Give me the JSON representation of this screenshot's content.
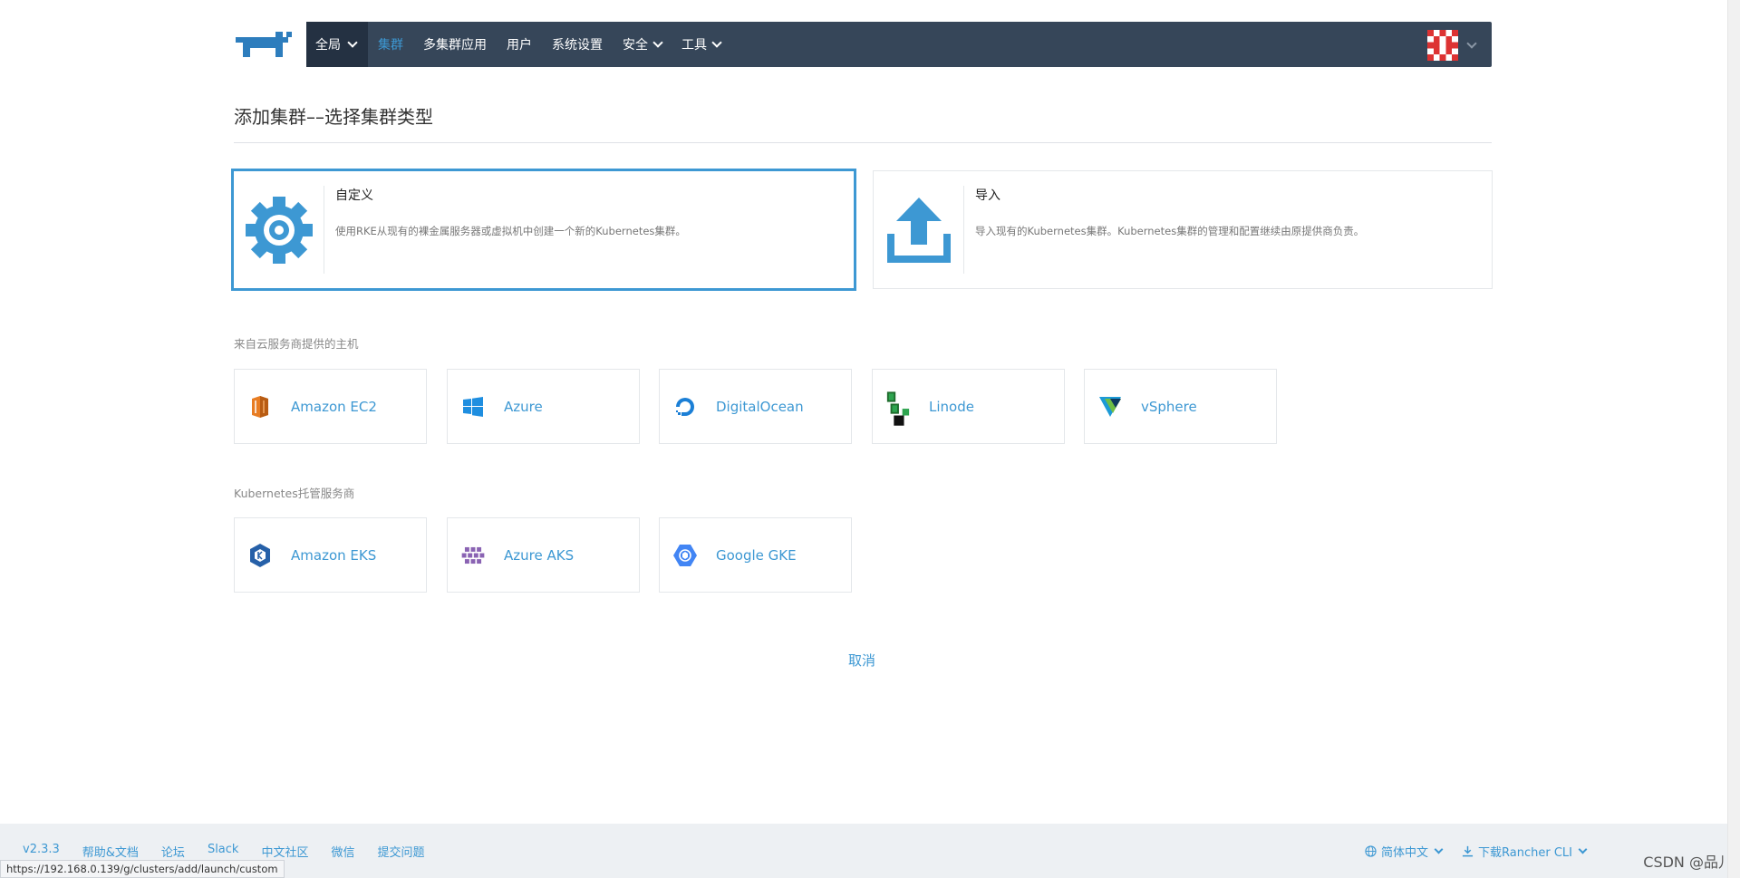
{
  "nav": {
    "scope": "全局",
    "items": [
      "集群",
      "多集群应用",
      "用户",
      "系统设置",
      "安全",
      "工具"
    ]
  },
  "page": {
    "title": "添加集群––选择集群类型"
  },
  "big_cards": [
    {
      "title": "自定义",
      "desc": "使用RKE从现有的裸金属服务器或虚拟机中创建一个新的Kubernetes集群。",
      "icon": "gear-icon"
    },
    {
      "title": "导入",
      "desc": "导入现有的Kubernetes集群。Kubernetes集群的管理和配置继续由原提供商负责。",
      "icon": "upload-icon"
    }
  ],
  "sections": {
    "cloud_hosts": "来自云服务商提供的主机",
    "k8s_hosted": "Kubernetes托管服务商"
  },
  "cloud_providers": [
    "Amazon EC2",
    "Azure",
    "DigitalOcean",
    "Linode",
    "vSphere"
  ],
  "hosted_providers": [
    "Amazon EKS",
    "Azure AKS",
    "Google GKE"
  ],
  "cancel_label": "取消",
  "footer": {
    "links": [
      "v2.3.3",
      "帮助&文档",
      "论坛",
      "Slack",
      "中文社区",
      "微信",
      "提交问题"
    ],
    "language": "简体中文",
    "download": "下载Rancher CLI"
  },
  "status_url": "https://192.168.0.139/g/clusters/add/launch/custom",
  "watermark": "CSDN @品儿",
  "colors": {
    "accent": "#3d98d3",
    "nav_bg": "#364659",
    "nav_scope_bg": "#243142"
  }
}
